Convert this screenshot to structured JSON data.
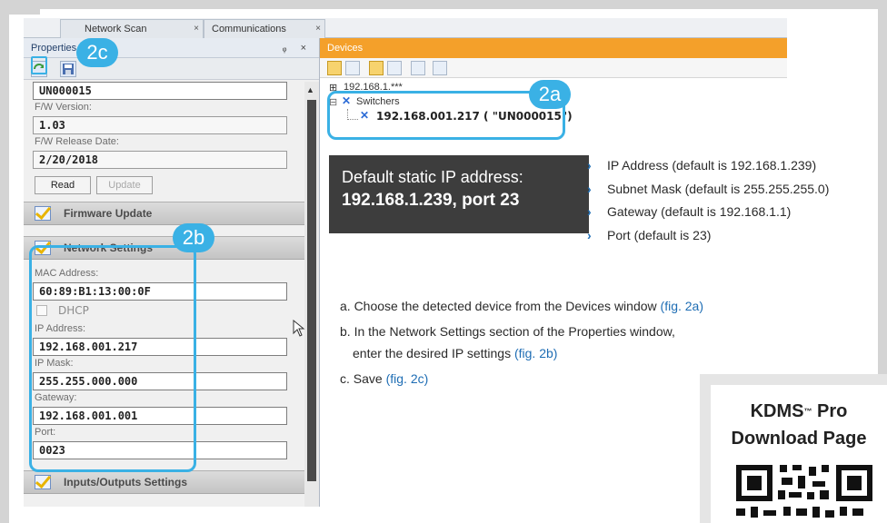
{
  "tabs": [
    {
      "label": "Network Scan",
      "close": "×"
    },
    {
      "label": "Communications",
      "close": "×"
    }
  ],
  "properties": {
    "title": "Properties",
    "title_controls": "ᵩ ×",
    "device_id": "UN000015",
    "fw_version_label": "F/W Version:",
    "fw_version": "1.03",
    "fw_date_label": "F/W Release Date:",
    "fw_date": "2/20/2018",
    "read_label": "Read",
    "update_label": "Update",
    "firmware_section": "Firmware Update",
    "network_section": "Network Settings",
    "mac_label": "MAC Address:",
    "mac": "60:89:B1:13:00:0F",
    "dhcp_label": "DHCP",
    "ip_label": "IP Address:",
    "ip": "192.168.001.217",
    "mask_label": "IP Mask:",
    "mask": "255.255.000.000",
    "gateway_label": "Gateway:",
    "gateway": "192.168.001.001",
    "port_label": "Port:",
    "port": "0023",
    "io_section": "Inputs/Outputs Settings"
  },
  "devices": {
    "title": "Devices",
    "root": "192.168.1.***",
    "group": "Switchers",
    "device": "192.168.001.217 ( \"UN000015\")"
  },
  "callouts": {
    "a": "2a",
    "b": "2b",
    "c": "2c"
  },
  "info": {
    "static_line1": "Default static IP address:",
    "static_line2": "192.168.1.239,  port 23",
    "bullets": [
      "IP Address (default is 192.168.1.239)",
      "Subnet Mask (default is 255.255.255.0)",
      "Gateway (default is 192.168.1.1)",
      "Port (default is 23)"
    ],
    "bullet_icon": "chevron-right-icon",
    "steps": [
      {
        "text": "a. Choose the detected device from the Devices window ",
        "fig": "(fig. 2a)"
      },
      {
        "text": "b. In the Network Settings section of the Properties window,",
        "fig": ""
      },
      {
        "text": "enter the desired IP settings ",
        "fig": "(fig. 2b)"
      },
      {
        "text": "c. Save ",
        "fig": "(fig. 2c)"
      }
    ]
  },
  "kdms": {
    "line1": "KDMS",
    "tm": "™",
    "line1b": " Pro",
    "line2": "Download Page"
  },
  "colors": {
    "callout": "#3ab1e5",
    "devices_header": "#f4a02a",
    "link_blue": "#1e6db4",
    "dark_box": "#3d3d3d"
  }
}
